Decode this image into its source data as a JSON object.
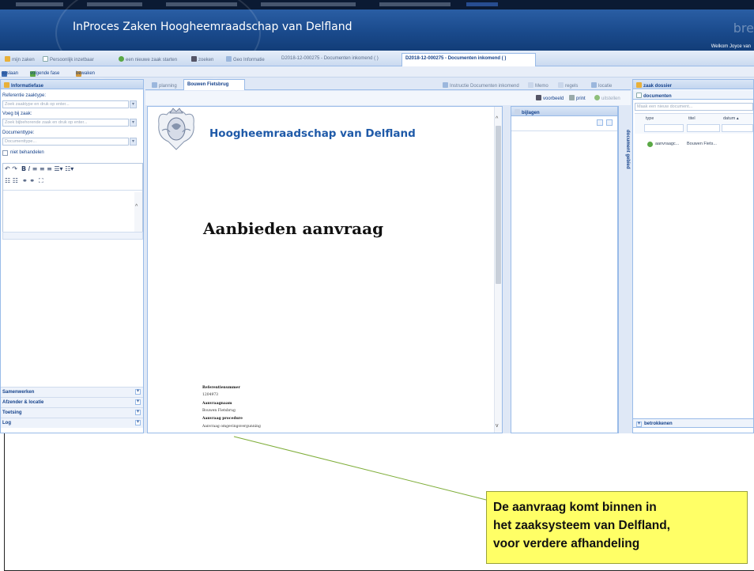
{
  "app": {
    "title": "InProces Zaken Hoogheemraadschap van Delfland",
    "brand_fragment": "bre",
    "welcome": "Welkom Joyce van"
  },
  "tabs": [
    {
      "label": "mijn zaken",
      "active": false
    },
    {
      "label": "Persoonlijk inzetbaar",
      "active": false
    },
    {
      "label": "een nieuwe zaak starten",
      "active": false
    },
    {
      "label": "zoeken",
      "active": false
    },
    {
      "label": "Geo Informatie",
      "active": false
    },
    {
      "label": "D2018-12-000275 - Documenten inkomend ( )",
      "active": false
    },
    {
      "label": "D2018-12-000275 - Documenten inkomend ( )",
      "active": true
    }
  ],
  "actions": {
    "opslaan": "opslaan",
    "volgende": "volgende fase",
    "bewaken": "bewaken"
  },
  "info_panel": {
    "title": "Informatiefase",
    "fields": [
      {
        "label": "Referentie zaaktype:",
        "placeholder": "Zoek zaaktype en druk op enter..."
      },
      {
        "label": "Voeg bij zaak:",
        "placeholder": "Zoek bijbehorende zaak en druk op enter..."
      },
      {
        "label": "Documenttype:",
        "placeholder": "Documenttype..."
      }
    ],
    "checkbox_label": "niet behandelen",
    "sections": [
      "Samenwerken",
      "Afzender & locatie",
      "Toetsing",
      "Log"
    ]
  },
  "doc_panel": {
    "tabs": [
      "planning",
      "Bouwen Fietsbrug"
    ],
    "toolbar": [
      "Instructie Documenten inkomend",
      "Memo",
      "regels",
      "locatie"
    ],
    "subtoolbar": [
      "voorbeeld",
      "print",
      "uitstellen"
    ],
    "org_name": "Hoogheemraadschap van Delfland",
    "heading": "Aanbieden aanvraag",
    "meta": [
      {
        "text": "Referentienummer",
        "bold": true
      },
      {
        "text": "1204973",
        "bold": false
      },
      {
        "text": "Aanvraagnaam",
        "bold": true
      },
      {
        "text": "Bouwen Fietsbrug",
        "bold": false
      },
      {
        "text": "Aanvraag procedure",
        "bold": true
      },
      {
        "text": "Aanvraag omgevingsvergunning",
        "bold": false
      }
    ]
  },
  "bijlagen": {
    "title": "bijlagen",
    "side_label": "document gebied"
  },
  "dossier": {
    "title": "zaak dossier",
    "section": "documenten",
    "new_placeholder": "Maak een nieuw document...",
    "columns": [
      "type",
      "titel",
      "datum"
    ],
    "rows": [
      {
        "type": "aanvraagc...",
        "titel": "Bouwen Fiets..."
      }
    ],
    "footer": "betrokkenen"
  },
  "annotation": {
    "lines": [
      "De aanvraag komt binnen in",
      "het zaaksysteem van Delfland,",
      "voor verdere afhandeling"
    ]
  },
  "colors": {
    "banner": "#1a4a8c",
    "panel_border": "#99bbe8",
    "callout": "#ffff66",
    "leader_line": "#7fae3a"
  }
}
